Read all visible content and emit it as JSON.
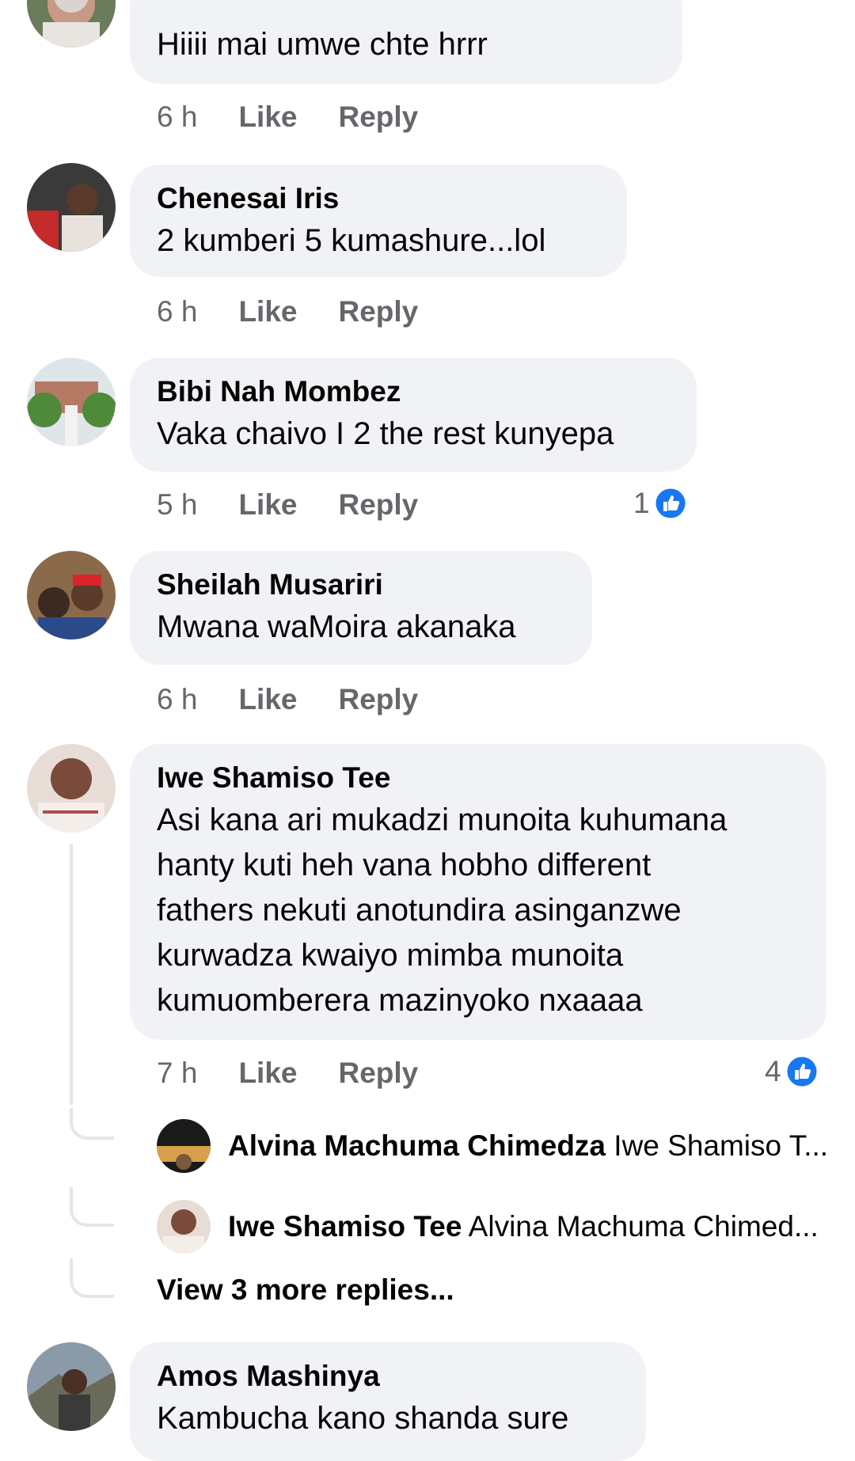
{
  "accent_color": "#1877f2",
  "comments": [
    {
      "author": "",
      "text": "Hiiii mai umwe chte hrrr",
      "time": "6 h",
      "like": "Like",
      "reply": "Reply"
    },
    {
      "author": "Chenesai Iris",
      "text": "2 kumberi 5 kumashure...lol",
      "time": "6 h",
      "like": "Like",
      "reply": "Reply"
    },
    {
      "author": "Bibi Nah Mombez",
      "text": "Vaka chaivo I 2 the rest kunyepa",
      "time": "5 h",
      "like": "Like",
      "reply": "Reply",
      "reactions": "1"
    },
    {
      "author": "Sheilah Musariri",
      "text": "Mwana waMoira akanaka",
      "time": "6 h",
      "like": "Like",
      "reply": "Reply"
    },
    {
      "author": "Iwe Shamiso Tee",
      "text_lines": [
        "Asi kana ari mukadzi munoita kuhumana",
        "hanty kuti heh vana hobho different",
        "fathers nekuti anotundira asinganzwe",
        "kurwadza kwaiyo mimba munoita",
        "kumuomberera mazinyoko nxaaaa"
      ],
      "time": "7 h",
      "like": "Like",
      "reply": "Reply",
      "reactions": "4",
      "replies": [
        {
          "author": "Alvina Machuma Chimedza",
          "text": "Iwe Shamiso T..."
        },
        {
          "author": "Iwe Shamiso Tee",
          "text": "Alvina Machuma Chimed..."
        }
      ],
      "view_more": "View 3 more replies..."
    },
    {
      "author": "Amos Mashinya",
      "text": "Kambucha kano shanda sure"
    }
  ],
  "icons": {
    "like_reaction": "thumbs-up-icon",
    "avatar": "avatar"
  }
}
